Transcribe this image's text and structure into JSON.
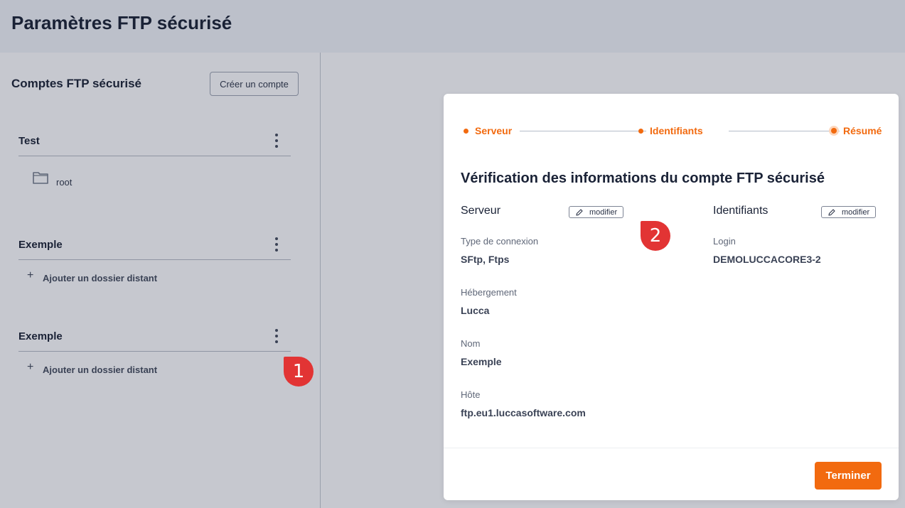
{
  "header": {
    "title": "Paramètres FTP sécurisé"
  },
  "sidebar": {
    "title": "Comptes FTP sécurisé",
    "create_label": "Créer un compte",
    "accounts": [
      {
        "name": "Test",
        "folder": "root"
      },
      {
        "name": "Exemple",
        "add_label": "Ajouter un dossier distant"
      },
      {
        "name": "Exemple",
        "add_label": "Ajouter un dossier distant"
      }
    ]
  },
  "markers": {
    "one": "1",
    "two": "2"
  },
  "modal": {
    "steps": [
      "Serveur",
      "Identifiants",
      "Résumé"
    ],
    "title": "Vérification des informations du compte FTP sécurisé",
    "server": {
      "heading": "Serveur",
      "edit_label": "modifier",
      "fields": [
        {
          "label": "Type de connexion",
          "value": "SFtp, Ftps"
        },
        {
          "label": "Hébergement",
          "value": "Lucca"
        },
        {
          "label": "Nom",
          "value": "Exemple"
        },
        {
          "label": "Hôte",
          "value": "ftp.eu1.luccasoftware.com"
        }
      ]
    },
    "credentials": {
      "heading": "Identifiants",
      "edit_label": "modifier",
      "fields": [
        {
          "label": "Login",
          "value": "DEMOLUCCACORE3-2"
        }
      ]
    },
    "finish_label": "Terminer"
  },
  "colors": {
    "accent": "#f26a0f",
    "marker": "#e23434"
  }
}
